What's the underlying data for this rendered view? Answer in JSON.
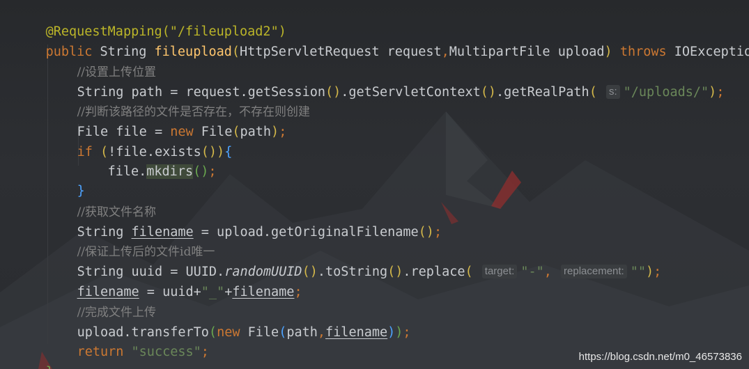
{
  "colors": {
    "annotation": "#bbb529",
    "keyword": "#cc7832",
    "string": "#6a8759",
    "function": "#ffc66d",
    "comment": "#808080",
    "text": "#c9ccd0",
    "background": "#2b2d2f"
  },
  "code": {
    "lines": [
      {
        "id": "ann",
        "text": "@RequestMapping(\"/fileupload2\")"
      },
      {
        "id": "sig"
      },
      {
        "id": "c1",
        "text": "//设置上传位置"
      },
      {
        "id": "path"
      },
      {
        "id": "c2",
        "text": "//判断该路径的文件是否存在，不存在则创建"
      },
      {
        "id": "file"
      },
      {
        "id": "if"
      },
      {
        "id": "mk"
      },
      {
        "id": "close1",
        "text": "}"
      },
      {
        "id": "c3",
        "text": "//获取文件名称"
      },
      {
        "id": "fname"
      },
      {
        "id": "c4",
        "text": "//保证上传后的文件id唯一"
      },
      {
        "id": "uuid"
      },
      {
        "id": "concat"
      },
      {
        "id": "c5",
        "text": "//完成文件上传"
      },
      {
        "id": "transfer"
      },
      {
        "id": "ret"
      },
      {
        "id": "close2",
        "text": "}"
      }
    ],
    "hints": {
      "s": "s:",
      "target": "target:",
      "replacement": "replacement:"
    }
  },
  "watermark": "https://blog.csdn.net/m0_46573836"
}
